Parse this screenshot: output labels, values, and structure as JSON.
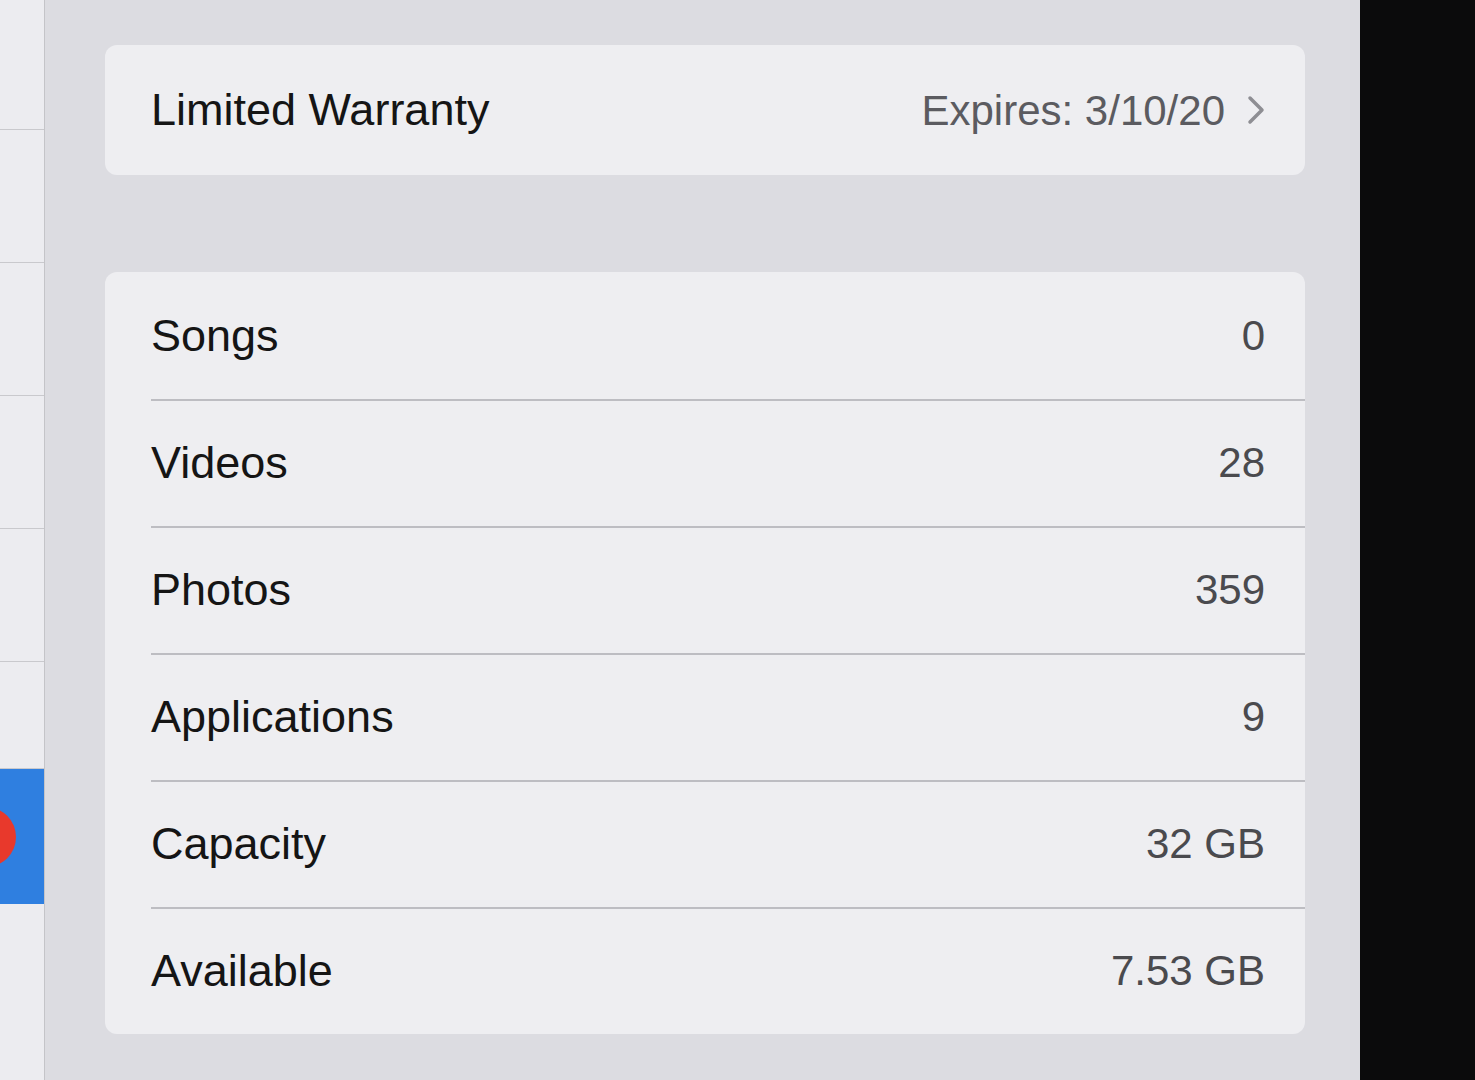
{
  "warranty": {
    "label": "Limited Warranty",
    "value": "Expires: 3/10/20"
  },
  "rows": [
    {
      "label": "Songs",
      "value": "0"
    },
    {
      "label": "Videos",
      "value": "28"
    },
    {
      "label": "Photos",
      "value": "359"
    },
    {
      "label": "Applications",
      "value": "9"
    },
    {
      "label": "Capacity",
      "value": "32 GB"
    },
    {
      "label": "Available",
      "value": "7.53 GB"
    }
  ]
}
